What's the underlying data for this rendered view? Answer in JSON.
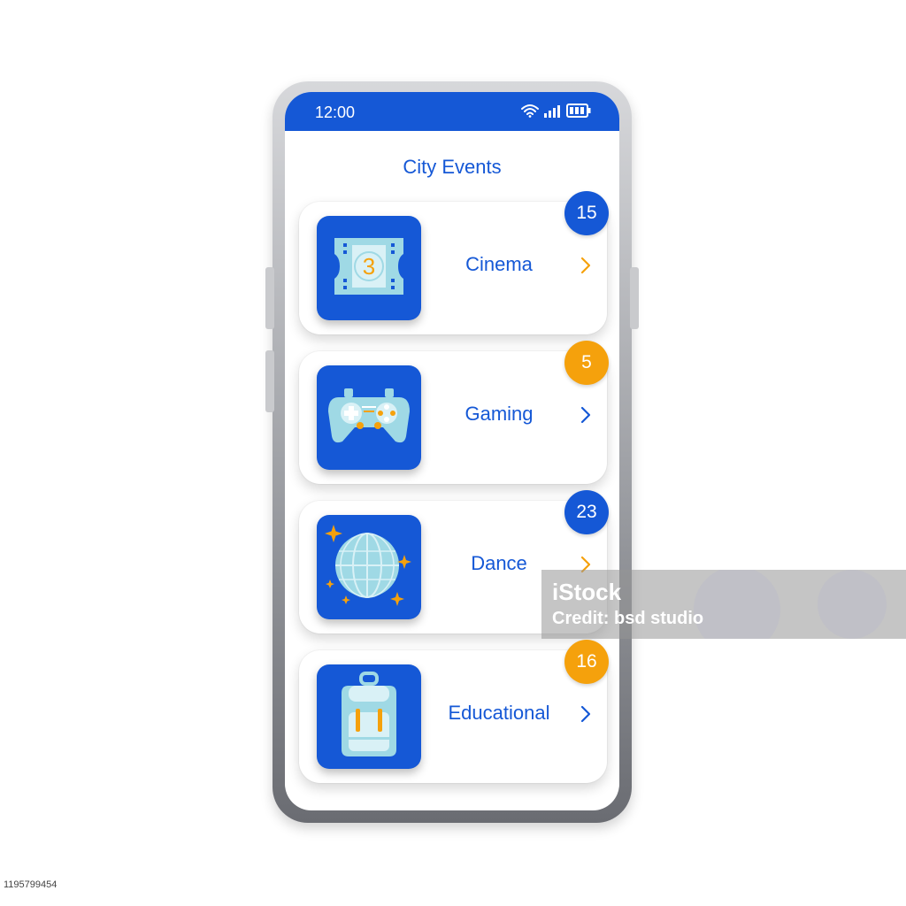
{
  "status_bar": {
    "time": "12:00",
    "wifi_icon": "wifi-icon",
    "signal_icon": "signal-icon",
    "battery_icon": "battery-icon"
  },
  "app": {
    "title": "City Events"
  },
  "colors": {
    "primary": "#1558d6",
    "accent": "#f5a10c",
    "icon_fill": "#9fd9e5"
  },
  "categories": [
    {
      "label": "Cinema",
      "count": "15",
      "badge_color": "#1558d6",
      "icon": "film-ticket-icon"
    },
    {
      "label": "Gaming",
      "count": "5",
      "badge_color": "#f5a10c",
      "icon": "gamepad-icon"
    },
    {
      "label": "Dance",
      "count": "23",
      "badge_color": "#1558d6",
      "icon": "disco-ball-icon"
    },
    {
      "label": "Educational",
      "count": "16",
      "badge_color": "#f5a10c",
      "icon": "backpack-icon"
    }
  ],
  "watermark": {
    "brand": "iStock",
    "credit": "Credit: bsd studio"
  },
  "image_id": "1195799454"
}
